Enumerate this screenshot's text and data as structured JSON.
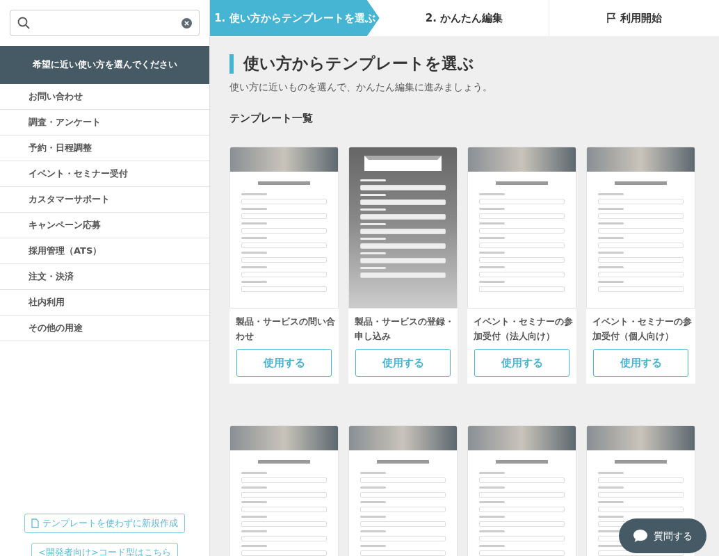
{
  "steps": [
    {
      "label": "1. 使い方からテンプレートを選ぶ",
      "selected": true,
      "kind": "step"
    },
    {
      "label": "2. かんたん編集",
      "selected": false,
      "kind": "step"
    },
    {
      "label": "利用開始",
      "selected": false,
      "kind": "goal"
    }
  ],
  "sidebar": {
    "header": "希望に近い使い方を選んでください",
    "items": [
      "お問い合わせ",
      "調査・アンケート",
      "予約・日程調整",
      "イベント・セミナー受付",
      "カスタマーサポート",
      "キャンペーン応募",
      "採用管理（ATS）",
      "注文・決済",
      "社内利用",
      "その他の用途"
    ],
    "footer_buttons": [
      {
        "label": "テンプレートを使わずに新規作成",
        "kind": "document"
      },
      {
        "label": "<開発者向け>コード型はこちら",
        "kind": "plain"
      }
    ]
  },
  "main": {
    "title": "使い方からテンプレートを選ぶ",
    "subtitle": "使い方に近いものを選んで、かんたん編集に進みましょう。",
    "section_title": "テンプレート一覧",
    "templates": [
      {
        "kind": "banner",
        "name": "製品・サービスの問い合わせ",
        "button": "使用する"
      },
      {
        "kind": "backdrop",
        "name": "製品・サービスの登録・申し込み",
        "button": "使用する"
      },
      {
        "kind": "banner",
        "name": "イベント・セミナーの参加受付（法人向け）",
        "button": "使用する"
      },
      {
        "kind": "banner",
        "name": "イベント・セミナーの参加受付（個人向け）",
        "button": "使用する"
      },
      {
        "kind": "banner"
      },
      {
        "kind": "banner"
      },
      {
        "kind": "banner"
      },
      {
        "kind": "banner"
      }
    ]
  },
  "chat_button": {
    "label": "質問する"
  }
}
